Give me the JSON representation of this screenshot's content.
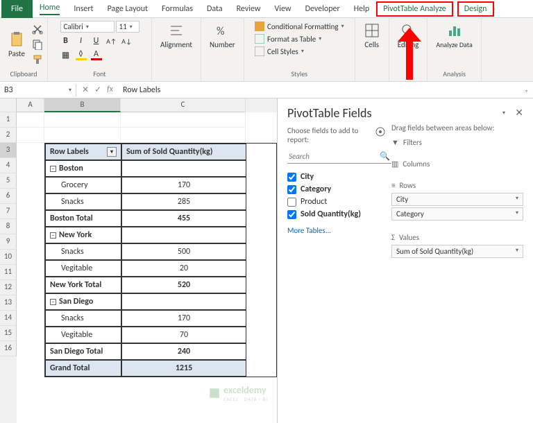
{
  "ribbon": {
    "file": "File",
    "tabs": [
      "Home",
      "Insert",
      "Page Layout",
      "Formulas",
      "Data",
      "Review",
      "View",
      "Developer",
      "Help",
      "PivotTable Analyze",
      "Design"
    ],
    "active": "Home",
    "callouts": [
      "PivotTable Analyze",
      "Design"
    ],
    "clipboard": {
      "label": "Clipboard",
      "paste": "Paste"
    },
    "font": {
      "label": "Font",
      "name": "Calibri",
      "size": "11"
    },
    "alignment": {
      "label": "Alignment",
      "btn": "Alignment"
    },
    "number": {
      "label": "Number",
      "btn": "Number"
    },
    "styles": {
      "label": "Styles",
      "cond": "Conditional Formatting",
      "table": "Format as Table",
      "cell": "Cell Styles"
    },
    "cells": {
      "label": "Cells",
      "btn": "Cells"
    },
    "editing": {
      "label": "Editing",
      "btn": "Editing"
    },
    "analysis": {
      "label": "Analysis",
      "btn": "Analyze Data"
    }
  },
  "fbar": {
    "name": "B3",
    "value": "Row Labels"
  },
  "cols": {
    "A": "A",
    "B": "B",
    "C": "C"
  },
  "pivot": {
    "hdr_b": "Row Labels",
    "hdr_c": "Sum of Sold Quantity(kg)",
    "rows": [
      {
        "b": "Boston",
        "c": "",
        "type": "group"
      },
      {
        "b": "Grocery",
        "c": "170",
        "type": "item"
      },
      {
        "b": "Snacks",
        "c": "285",
        "type": "item"
      },
      {
        "b": "Boston Total",
        "c": "455",
        "type": "total"
      },
      {
        "b": "New York",
        "c": "",
        "type": "group"
      },
      {
        "b": "Snacks",
        "c": "500",
        "type": "item"
      },
      {
        "b": "Vegitable",
        "c": "20",
        "type": "item"
      },
      {
        "b": "New York Total",
        "c": "520",
        "type": "total"
      },
      {
        "b": "San Diego",
        "c": "",
        "type": "group"
      },
      {
        "b": "Snacks",
        "c": "170",
        "type": "item"
      },
      {
        "b": "Vegitable",
        "c": "70",
        "type": "item"
      },
      {
        "b": "San Diego Total",
        "c": "240",
        "type": "total"
      },
      {
        "b": "Grand Total",
        "c": "1215",
        "type": "grand"
      }
    ]
  },
  "pane": {
    "title": "PivotTable Fields",
    "sub": "Choose fields to add to report:",
    "search": "Search",
    "fields": [
      {
        "name": "City",
        "checked": true,
        "bold": true
      },
      {
        "name": "Category",
        "checked": true,
        "bold": true
      },
      {
        "name": "Product",
        "checked": false,
        "bold": false
      },
      {
        "name": "Sold Quantity(kg)",
        "checked": true,
        "bold": true
      }
    ],
    "more": "More Tables...",
    "drag": "Drag fields between areas below:",
    "areas": {
      "filters": "Filters",
      "columns": "Columns",
      "rows": "Rows",
      "rows_items": [
        "City",
        "Category"
      ],
      "values": "Values",
      "values_items": [
        "Sum of Sold Quantity(kg)"
      ]
    }
  },
  "watermark": "exceldemy",
  "watermark_sub": "EXCEL · DATA · BI"
}
